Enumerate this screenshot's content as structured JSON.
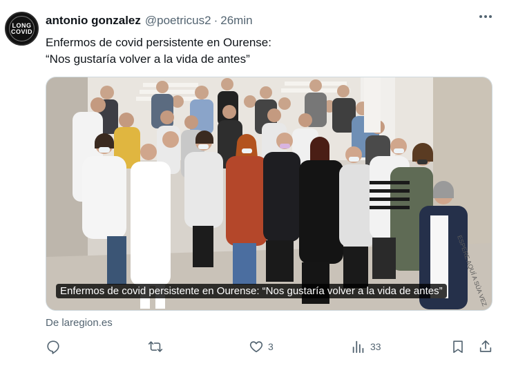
{
  "tweet": {
    "author_name": "antonio gonzalez",
    "handle": "@poetricus2",
    "separator": "·",
    "time": "26min",
    "text_line1": "Enfermos de covid persistente en Ourense:",
    "text_line2": " “Nos gustaría volver a la vida de antes”",
    "avatar": {
      "line1": "LONG",
      "line2": "COVID"
    },
    "media": {
      "caption": "Enfermos de covid persistente en Ourense: “Nos gustaría volver a la vida de antes”",
      "description_icon": "group-photo"
    },
    "source": "De laregion.es",
    "actions": {
      "reply_count": "",
      "retweet_count": "",
      "like_count": "3",
      "views_count": "33"
    }
  },
  "colors": {
    "text_primary": "#0f1419",
    "text_secondary": "#536471",
    "border": "#cfd9de"
  }
}
